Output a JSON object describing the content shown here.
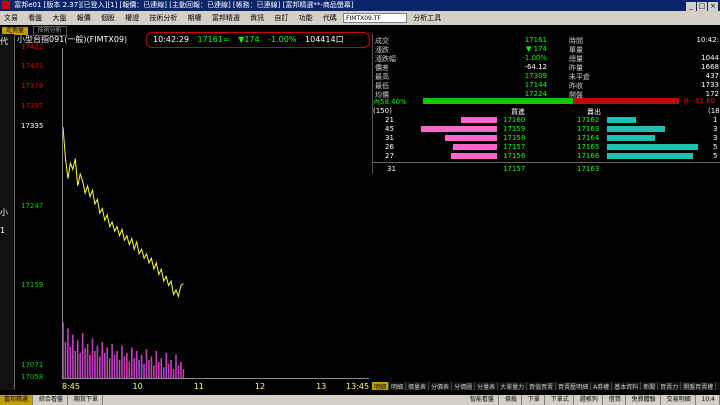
{
  "window": {
    "title": "富邦e01 [版本 2.37][已登入][1] [報價：已連線] [主動回報：已連線] [帳務：已連線]    [富邦精選**-商品螢幕]"
  },
  "menubar": {
    "items": [
      "文易",
      "看盤",
      "大盤",
      "報價",
      "個股",
      "權證",
      "技術分析",
      "期權",
      "富邦精選",
      "資訊",
      "自訂",
      "功能"
    ],
    "symbol_label": "代碼",
    "symbol_value": "FIMTX09.TF",
    "tool_label": "分析工具"
  },
  "tabs": {
    "active": "走勢量",
    "other": "技術分析"
  },
  "chart": {
    "title": "小型台指091(一般)(FIMTX09)",
    "quote_time": "10:42:29",
    "quote_price": "17161",
    "quote_eq": "=",
    "quote_change": "▼174",
    "quote_pct": "-1.00%",
    "quote_volume": "104414",
    "quote_suffix": "口",
    "left_strip_top": "代",
    "left_strip_mid": "小",
    "left_strip_mid2": "1"
  },
  "chart_data": {
    "type": "line",
    "title": "",
    "xlabel": "",
    "ylabel": "",
    "x_ticks": [
      "8:45",
      "10",
      "11",
      "12",
      "13",
      "13:45"
    ],
    "y_ticks": [
      17422,
      17401,
      17379,
      17357,
      17335,
      17247,
      17159,
      17071,
      17058
    ],
    "y_tick_colors": [
      "#e00000",
      "#e00000",
      "#e00000",
      "#e00000",
      "#ffffff",
      "#00cc00",
      "#00cc00",
      "#00cc00",
      "#00cc00"
    ],
    "ylim": [
      17058,
      17422
    ],
    "reference_price": 17335,
    "series": [
      {
        "values": [
          17335,
          17300,
          17278,
          17295,
          17288,
          17300,
          17270,
          17283,
          17275,
          17262,
          17270,
          17258,
          17265,
          17250,
          17255,
          17240,
          17245,
          17232,
          17238,
          17225,
          17230,
          17220,
          17225,
          17215,
          17222,
          17210,
          17215,
          17205,
          17212,
          17200,
          17208,
          17195,
          17200,
          17190,
          17195,
          17185,
          17190,
          17178,
          17185,
          17172,
          17178,
          17165,
          17170,
          17160,
          17165,
          17150,
          17155,
          17148,
          17160,
          17162
        ]
      }
    ],
    "volume": [
      62,
      40,
      55,
      35,
      48,
      30,
      42,
      28,
      50,
      33,
      38,
      26,
      44,
      30,
      36,
      24,
      40,
      28,
      34,
      22,
      38,
      26,
      30,
      20,
      36,
      24,
      28,
      18,
      34,
      22,
      30,
      20,
      26,
      16,
      32,
      20,
      24,
      14,
      30,
      18,
      22,
      12,
      28,
      16,
      20,
      10,
      26,
      14,
      18,
      10
    ],
    "x_tick_colors": [
      "#ffff66",
      "#ffff66",
      "#ffff66",
      "#ffff66",
      "#ffff66",
      "#ffff66"
    ]
  },
  "quotes": {
    "left_labels": [
      "成交",
      "漲跌",
      "漲跌幅",
      "價差",
      "最高",
      "最低",
      "均價"
    ],
    "left_values": [
      "17161",
      "▼ 174",
      "-1.00%",
      "-64.12",
      "17309",
      "17144",
      "17224"
    ],
    "right_labels": [
      "時間",
      "單量",
      "總量",
      "昨量",
      "未平倉",
      "昨收",
      "開盤"
    ],
    "right_values": [
      "10:42:",
      "",
      "1044",
      "1668",
      "437",
      "1733",
      "172"
    ],
    "ratio_left": "內58.40%",
    "ratio_right": "外",
    "ratio_right_val": "41.60",
    "ratio_fill": 0.584
  },
  "orderbook": {
    "bid_header": "買進",
    "ask_header": "賣出",
    "bid_total": "(150)",
    "ask_total": "(18",
    "bids": [
      {
        "qty": "21",
        "price": "17160",
        "bar": 0.45
      },
      {
        "qty": "45",
        "price": "17159",
        "bar": 0.95
      },
      {
        "qty": "31",
        "price": "17158",
        "bar": 0.65
      },
      {
        "qty": "26",
        "price": "17157",
        "bar": 0.55
      },
      {
        "qty": "27",
        "price": "17156",
        "bar": 0.57
      }
    ],
    "asks": [
      {
        "price": "17162",
        "qty": "1",
        "bar": 0.3
      },
      {
        "price": "17163",
        "qty": "3",
        "bar": 0.6
      },
      {
        "price": "17164",
        "qty": "3",
        "bar": 0.5
      },
      {
        "price": "17165",
        "qty": "5",
        "bar": 0.95
      },
      {
        "price": "17166",
        "qty": "5",
        "bar": 0.9
      }
    ],
    "last_bid_qty": "31",
    "last_bid": "17157",
    "last_ask": "17163"
  },
  "bottom_tabs": [
    "明細",
    "明細",
    "價量表",
    "分價表",
    "分價圖",
    "分量表",
    "大單量力",
    "買值買賣",
    "買賣壓明細",
    "A券權",
    "基本資料",
    "新聞",
    "買賣力",
    "開盤買賣權"
  ],
  "statusbar": {
    "items": [
      "富邦精選",
      "綜合看盤",
      "期貨下單"
    ],
    "right_items": [
      "智能看盤",
      "條殺",
      "下單",
      "下單式",
      "證帳列",
      "借貸",
      "免費體驗",
      "交易明細"
    ],
    "clock": "10:4"
  }
}
